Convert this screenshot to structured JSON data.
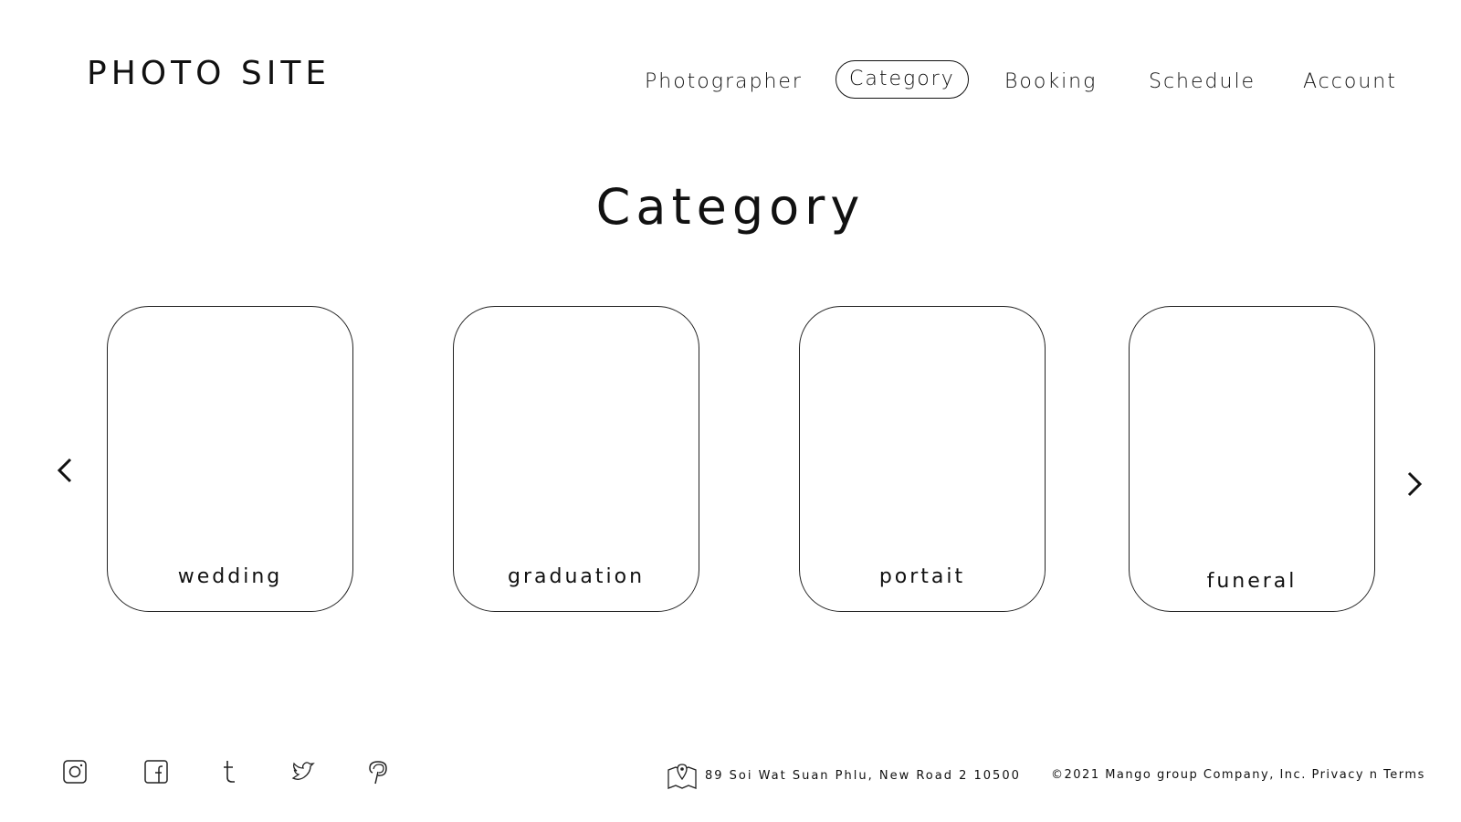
{
  "site": {
    "logo": "PHOTO SITE"
  },
  "nav": {
    "items": [
      {
        "label": "Photographer"
      },
      {
        "label": "Category",
        "active": true
      },
      {
        "label": "Booking"
      },
      {
        "label": "Schedule"
      },
      {
        "label": "Account"
      }
    ]
  },
  "main": {
    "title": "Category",
    "cards": [
      {
        "label": "wedding"
      },
      {
        "label": "graduation"
      },
      {
        "label": "portait"
      },
      {
        "label": "funeral"
      }
    ],
    "prev_icon": "chevron-left-icon",
    "next_icon": "chevron-right-icon"
  },
  "footer": {
    "social_icons": [
      "instagram-icon",
      "facebook-icon",
      "tumblr-icon",
      "twitter-icon",
      "pinterest-icon"
    ],
    "address": "89 Soi Wat Suan Phlu, New Road 2 10500",
    "copyright": "©2021 Mango group Company, Inc.",
    "privacy_link": "Privacy",
    "conjunction": "n",
    "terms_link": "Terms"
  }
}
